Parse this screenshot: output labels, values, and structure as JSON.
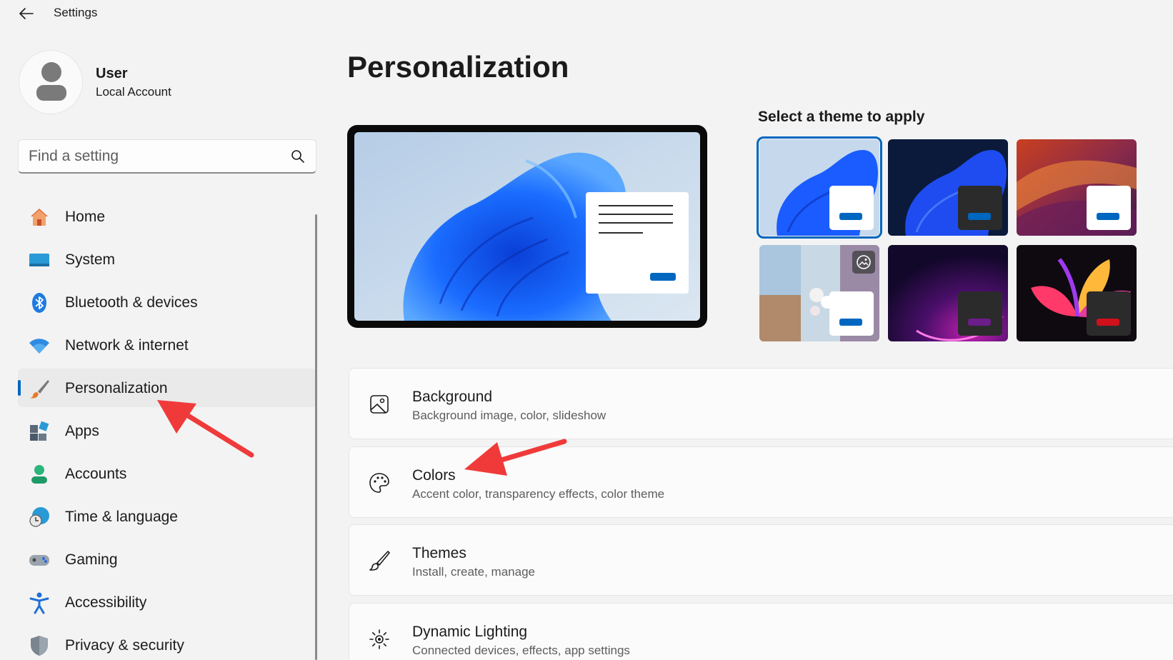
{
  "window": {
    "title": "Settings"
  },
  "user": {
    "name": "User",
    "account_type": "Local Account"
  },
  "search": {
    "placeholder": "Find a setting"
  },
  "sidebar": {
    "items": [
      {
        "label": "Home",
        "icon": "home-icon"
      },
      {
        "label": "System",
        "icon": "system-icon"
      },
      {
        "label": "Bluetooth & devices",
        "icon": "bluetooth-icon"
      },
      {
        "label": "Network & internet",
        "icon": "wifi-icon"
      },
      {
        "label": "Personalization",
        "icon": "paintbrush-icon",
        "active": true
      },
      {
        "label": "Apps",
        "icon": "apps-icon"
      },
      {
        "label": "Accounts",
        "icon": "accounts-icon"
      },
      {
        "label": "Time & language",
        "icon": "time-language-icon"
      },
      {
        "label": "Gaming",
        "icon": "gamepad-icon"
      },
      {
        "label": "Accessibility",
        "icon": "accessibility-icon"
      },
      {
        "label": "Privacy & security",
        "icon": "shield-icon"
      }
    ]
  },
  "main": {
    "title": "Personalization",
    "theme_heading": "Select a theme to apply",
    "themes": [
      {
        "name": "windows-light",
        "selected": true,
        "window_color": "#ffffff",
        "accent": "#0067c0"
      },
      {
        "name": "windows-dark",
        "window_color": "#2b2b2b",
        "accent": "#0067c0"
      },
      {
        "name": "glow",
        "window_color": "#ffffff",
        "accent": "#0067c0"
      },
      {
        "name": "captured-motion",
        "window_color": "#ffffff",
        "accent": "#0067c0",
        "slideshow": true
      },
      {
        "name": "sunrise",
        "window_color": "#2b2b2b",
        "accent": "#6b1d8a"
      },
      {
        "name": "flow",
        "window_color": "#2b2b2b",
        "accent": "#d0101b"
      }
    ],
    "cards": [
      {
        "title": "Background",
        "subtitle": "Background image, color, slideshow",
        "icon": "image-icon"
      },
      {
        "title": "Colors",
        "subtitle": "Accent color, transparency effects, color theme",
        "icon": "palette-icon"
      },
      {
        "title": "Themes",
        "subtitle": "Install, create, manage",
        "icon": "brush-icon"
      },
      {
        "title": "Dynamic Lighting",
        "subtitle": "Connected devices, effects, app settings",
        "icon": "lighting-icon"
      }
    ]
  },
  "colors": {
    "accent": "#0067c0",
    "annotation_arrow": "#f03a3a"
  }
}
